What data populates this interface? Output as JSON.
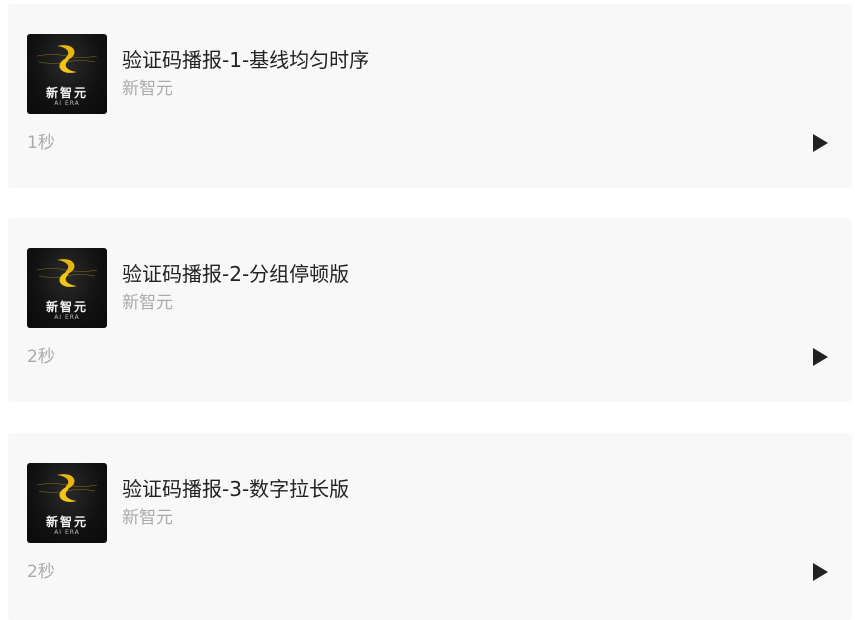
{
  "tracks": [
    {
      "title": "验证码播报-1-基线均匀时序",
      "artist": "新智元",
      "duration": "1秒",
      "cover": {
        "brand": "新智元",
        "sub": "AI ERA"
      }
    },
    {
      "title": "验证码播报-2-分组停顿版",
      "artist": "新智元",
      "duration": "2秒",
      "cover": {
        "brand": "新智元",
        "sub": "AI ERA"
      }
    },
    {
      "title": "验证码播报-3-数字拉长版",
      "artist": "新智元",
      "duration": "2秒",
      "cover": {
        "brand": "新智元",
        "sub": "AI ERA"
      }
    }
  ],
  "icons": {
    "play": "play-icon",
    "logo": "xinzhiyuan-logo-icon"
  },
  "colors": {
    "card_bg": "#f8f8f8",
    "title": "#222222",
    "muted": "#aaaaaa",
    "logo_gold": "#e8b512"
  }
}
